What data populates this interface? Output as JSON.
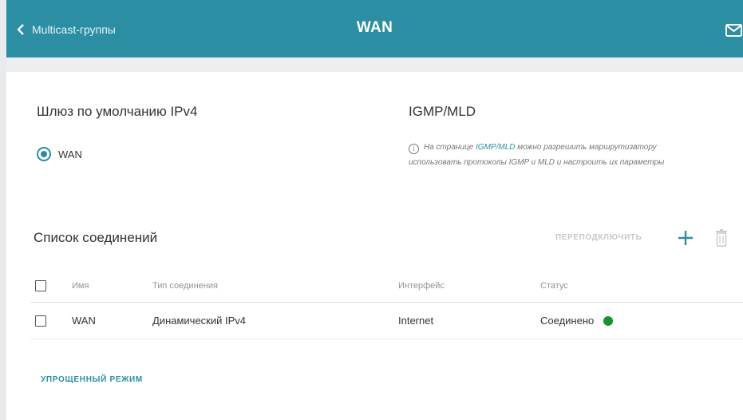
{
  "header": {
    "back_label": "Multicast-группы",
    "title": "WAN"
  },
  "gateway": {
    "title": "Шлюз по умолчанию IPv4",
    "option_label": "WAN",
    "selected": true
  },
  "igmp": {
    "title": "IGMP/MLD",
    "info_prefix": "На странице ",
    "info_link": "IGMP/MLD",
    "info_suffix": " можно разрешить маршрутизатору использовать протоколы IGMP и MLD и настроить их параметры"
  },
  "connections": {
    "title": "Список соединений",
    "reconnect_label": "ПЕРЕПОДКЛЮЧИТЬ",
    "columns": [
      "Имя",
      "Тип соединения",
      "Интерфейс",
      "Статус"
    ],
    "rows": [
      {
        "name": "WAN",
        "type": "Динамический IPv4",
        "interface": "Internet",
        "status": "Соединено"
      }
    ]
  },
  "simple_mode_label": "УПРОЩЕННЫЙ РЕЖИМ",
  "colors": {
    "accent": "#2b8ea3",
    "status_connected": "#17932a"
  },
  "icons": [
    "chevron-left-icon",
    "mail-icon",
    "info-icon",
    "plus-icon",
    "trash-icon"
  ]
}
